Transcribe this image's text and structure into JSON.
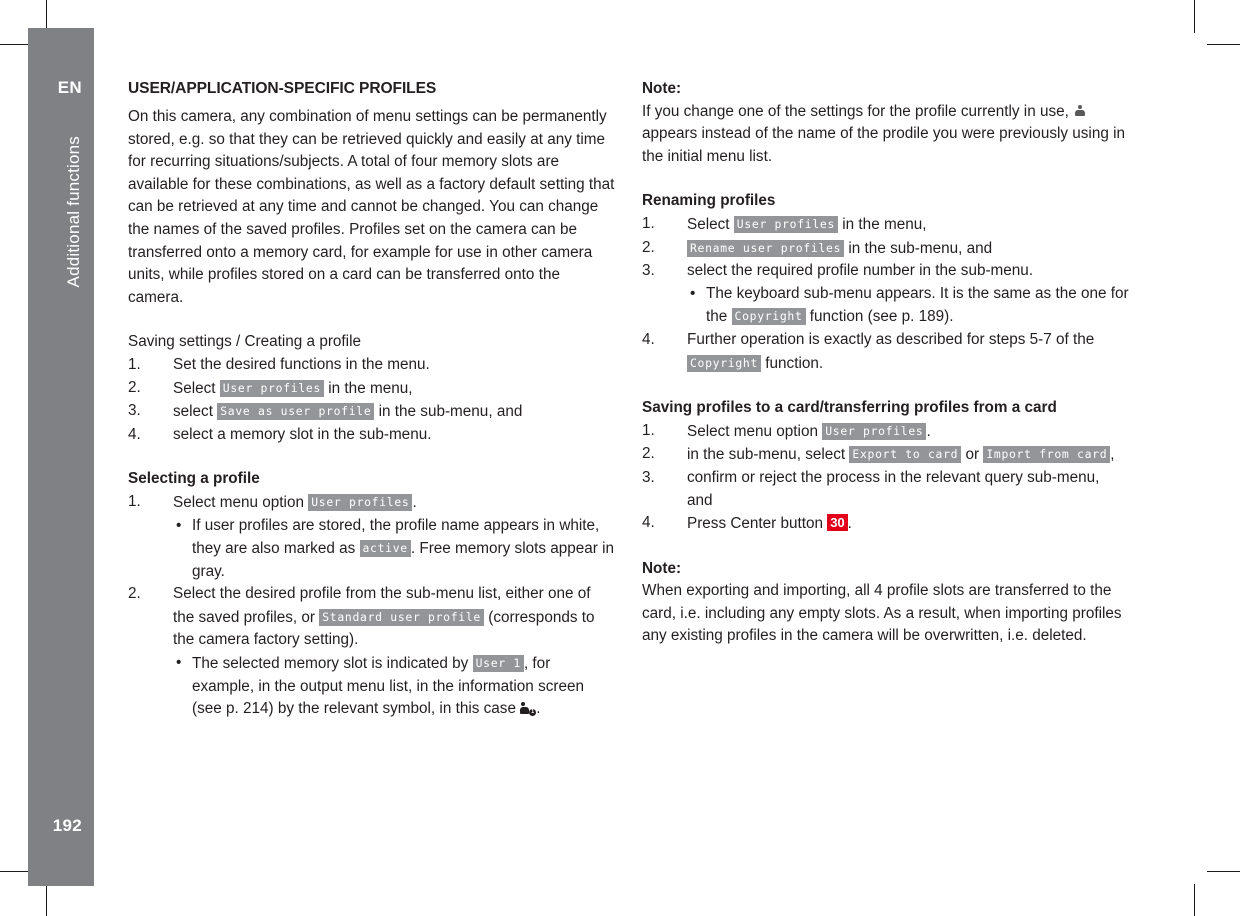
{
  "sidebar": {
    "language": "EN",
    "chapter": "Additional functions",
    "page_number": "192",
    "background_color": "#808184"
  },
  "left_column": {
    "section_title": "USER/APPLICATION-SPECIFIC PROFILES",
    "intro_paragraph": "On this camera, any combination of menu settings can be permanently stored, e.g. so that they can be retrieved quickly and easily at any time for recurring situations/subjects. A total of four memory slots are available for these combinations, as well as a factory default setting that can be retrieved at any time and cannot be changed. You can change the names of the saved profiles. Profiles set on the camera can be transferred onto a memory card, for example for use in other camera units, while profiles stored on a card can be transferred onto the camera.",
    "saving_heading": "Saving settings / Creating a profile",
    "saving_steps": [
      {
        "num": "1.",
        "pre": "Set the desired functions in the menu.",
        "menu": "",
        "post": ""
      },
      {
        "num": "2.",
        "pre": "Select ",
        "menu": "User profiles",
        "post": " in the menu,"
      },
      {
        "num": "3.",
        "pre": "select ",
        "menu": "Save as user profile",
        "post": " in the sub-menu, and"
      },
      {
        "num": "4.",
        "pre": "select a memory slot in the sub-menu.",
        "menu": "",
        "post": ""
      }
    ],
    "selecting_heading": "Selecting a profile",
    "selecting_step1": {
      "num": "1.",
      "pre": "Select menu option ",
      "menu": "User profiles",
      "post": "."
    },
    "selecting_step1_bullet": {
      "pre": "If user profiles are stored, the profile name appears in white, they are also marked as ",
      "menu": "active",
      "post": ". Free memory slots appear in gray."
    },
    "selecting_step2": {
      "num": "2.",
      "pre": "Select the desired profile from the sub-menu list, either one of the saved profiles, or ",
      "menu": "Standard user profile",
      "post": " (corresponds to the camera factory setting)."
    },
    "selecting_step2_bullet": {
      "pre": "The selected memory slot is indicated by ",
      "menu": "User 1",
      "mid": ", for example, in the output menu list, in the information screen (see p. 214) by the relevant symbol, in this case ",
      "symbol": "user-profile-1-icon",
      "post": "."
    }
  },
  "right_column": {
    "note1_label": "Note:",
    "note1_pre": "If you change one of the settings for the profile currently in use, ",
    "note1_symbol": "person-bust-icon",
    "note1_post": " appears instead of the name of the prodile you were previously using in the initial menu list.",
    "renaming_heading": "Renaming profiles",
    "renaming_steps": [
      {
        "num": "1.",
        "pre": "Select ",
        "menu": "User profiles",
        "post": " in the menu,"
      },
      {
        "num": "2.",
        "pre": "",
        "menu": "Rename user profiles",
        "post": " in the sub-menu, and"
      },
      {
        "num": "3.",
        "pre": "select the required profile number in the sub-menu.",
        "menu": "",
        "post": ""
      }
    ],
    "renaming_step3_bullet": {
      "pre": "The keyboard sub-menu appears. It is the same as the one for the ",
      "menu": "Copyright",
      "post": " function (see p. 189)."
    },
    "renaming_step4": {
      "num": "4.",
      "pre": "Further operation is exactly as described for steps 5-7 of the ",
      "menu": "Copyright",
      "post": " function."
    },
    "card_heading": "Saving profiles to a card/transferring profiles from a card",
    "card_step1": {
      "num": "1.",
      "pre": "Select menu option ",
      "menu": "User profiles",
      "post": "."
    },
    "card_step2": {
      "num": "2.",
      "pre": "in the sub-menu, select ",
      "menu1": "Export to card",
      "mid": " or ",
      "menu2": "Import from card",
      "post": ","
    },
    "card_step3": {
      "num": "3.",
      "text": "confirm or reject the process in the relevant query sub-menu, and"
    },
    "card_step4": {
      "num": "4.",
      "pre": "Press Center button ",
      "badge": "30",
      "post": "."
    },
    "note2_label": "Note:",
    "note2_text": "When exporting and importing, all 4 profile slots are transferred to the card, i.e. including any empty slots. As a result, when importing profiles any existing profiles in the camera will be overwritten, i.e. deleted.",
    "badge_color": "#e2001a"
  }
}
